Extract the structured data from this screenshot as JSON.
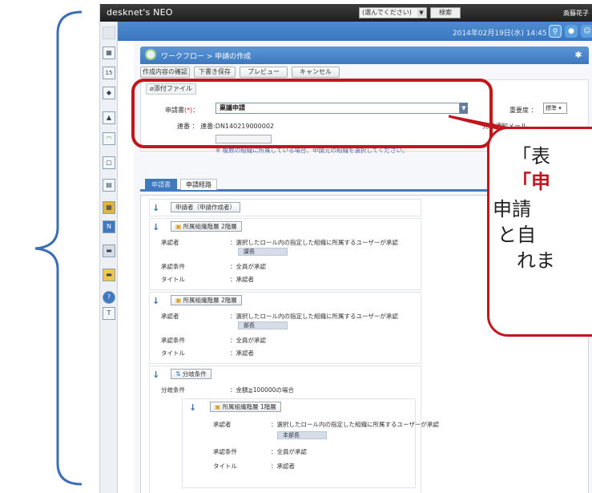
{
  "topbar": {
    "logo": "desknet's NEO",
    "search_select": "(選んでください)",
    "search_button": "検索",
    "user": "斎藤花子"
  },
  "datebar": {
    "datetime": "2014年02月19日(水) 14:45"
  },
  "page": {
    "title": "ワークフロー > 申請の作成",
    "buttons": [
      "作成内容の確認",
      "下書き保存",
      "プレビュー",
      "キャンセル"
    ]
  },
  "form": {
    "attach_tab": "添付ファイル",
    "applicant_label": "申請書",
    "applicant_req": "(*)",
    "applicant_colon": "：",
    "applicant_value": "稟議申請",
    "priority_label": "重要度 ：",
    "priority_value": "標準",
    "number_label": "連番 ： 連番:DN140219000002",
    "complete_label": "完了通知メール",
    "org_note": "※ 複数の組織に所属している場合、申請元の組織を選択してください。"
  },
  "tabs": [
    "申請書",
    "申請経路"
  ],
  "route": {
    "first_step": "申請者（申請作成者）",
    "steps": [
      {
        "head": "所属組織階層 2階層",
        "approver_label": "承認者",
        "approver_value": "：選択したロール内の指定した組織に所属するユーザーが承認",
        "role": "課長",
        "cond_label": "承認条件",
        "cond_value": "：全員が承認",
        "title_label": "タイトル",
        "title_value": "：承認者"
      },
      {
        "head": "所属組織階層 2階層",
        "approver_label": "承認者",
        "approver_value": "：選択したロール内の指定した組織に所属するユーザーが承認",
        "role": "部長",
        "cond_label": "承認条件",
        "cond_value": "：全員が承認",
        "title_label": "タイトル",
        "title_value": "：承認者"
      }
    ],
    "branch": {
      "head": "分岐条件",
      "cond_label": "分岐条件",
      "cond_value": "：金額≧100000の場合",
      "sub": {
        "head": "所属組織階層 1階層",
        "approver_label": "承認者",
        "approver_value": "：選択したロール内の指定した組織に所属するユーザーが承認",
        "role": "本部長",
        "cond_label": "承認条件",
        "cond_value": "：全員が承認",
        "title_label": "タイトル",
        "title_value": "：承認者"
      }
    }
  },
  "callout": {
    "line1": "「表",
    "line2": "「申",
    "line3": "申請",
    "line4": "と自",
    "line5": "れま"
  },
  "colors": {
    "accent": "#3d78c0",
    "callout_red": "#c0161d",
    "bracket": "#3a6fb7"
  }
}
